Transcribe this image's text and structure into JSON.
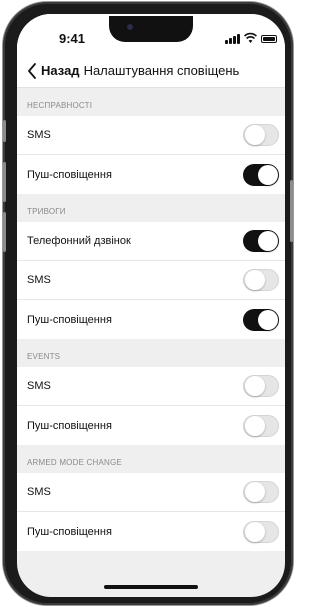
{
  "status_bar": {
    "time": "9:41"
  },
  "nav": {
    "back_label": "Назад",
    "title": "Налаштування сповіщень"
  },
  "sections": [
    {
      "header": "НЕСПРАВНОСТІ",
      "rows": [
        {
          "label": "SMS",
          "on": false
        },
        {
          "label": "Пуш-сповіщення",
          "on": true
        }
      ]
    },
    {
      "header": "ТРИВОГИ",
      "rows": [
        {
          "label": "Телефонний дзвінок",
          "on": true
        },
        {
          "label": "SMS",
          "on": false
        },
        {
          "label": "Пуш-сповіщення",
          "on": true
        }
      ]
    },
    {
      "header": "EVENTS",
      "rows": [
        {
          "label": "SMS",
          "on": false
        },
        {
          "label": "Пуш-сповіщення",
          "on": false
        }
      ]
    },
    {
      "header": "ARMED MODE CHANGE",
      "rows": [
        {
          "label": "SMS",
          "on": false
        },
        {
          "label": "Пуш-сповіщення",
          "on": false
        }
      ]
    }
  ],
  "colors": {
    "toggle_on": "#111111",
    "toggle_off": "#e6e6e6",
    "section_bg": "#efefef"
  }
}
